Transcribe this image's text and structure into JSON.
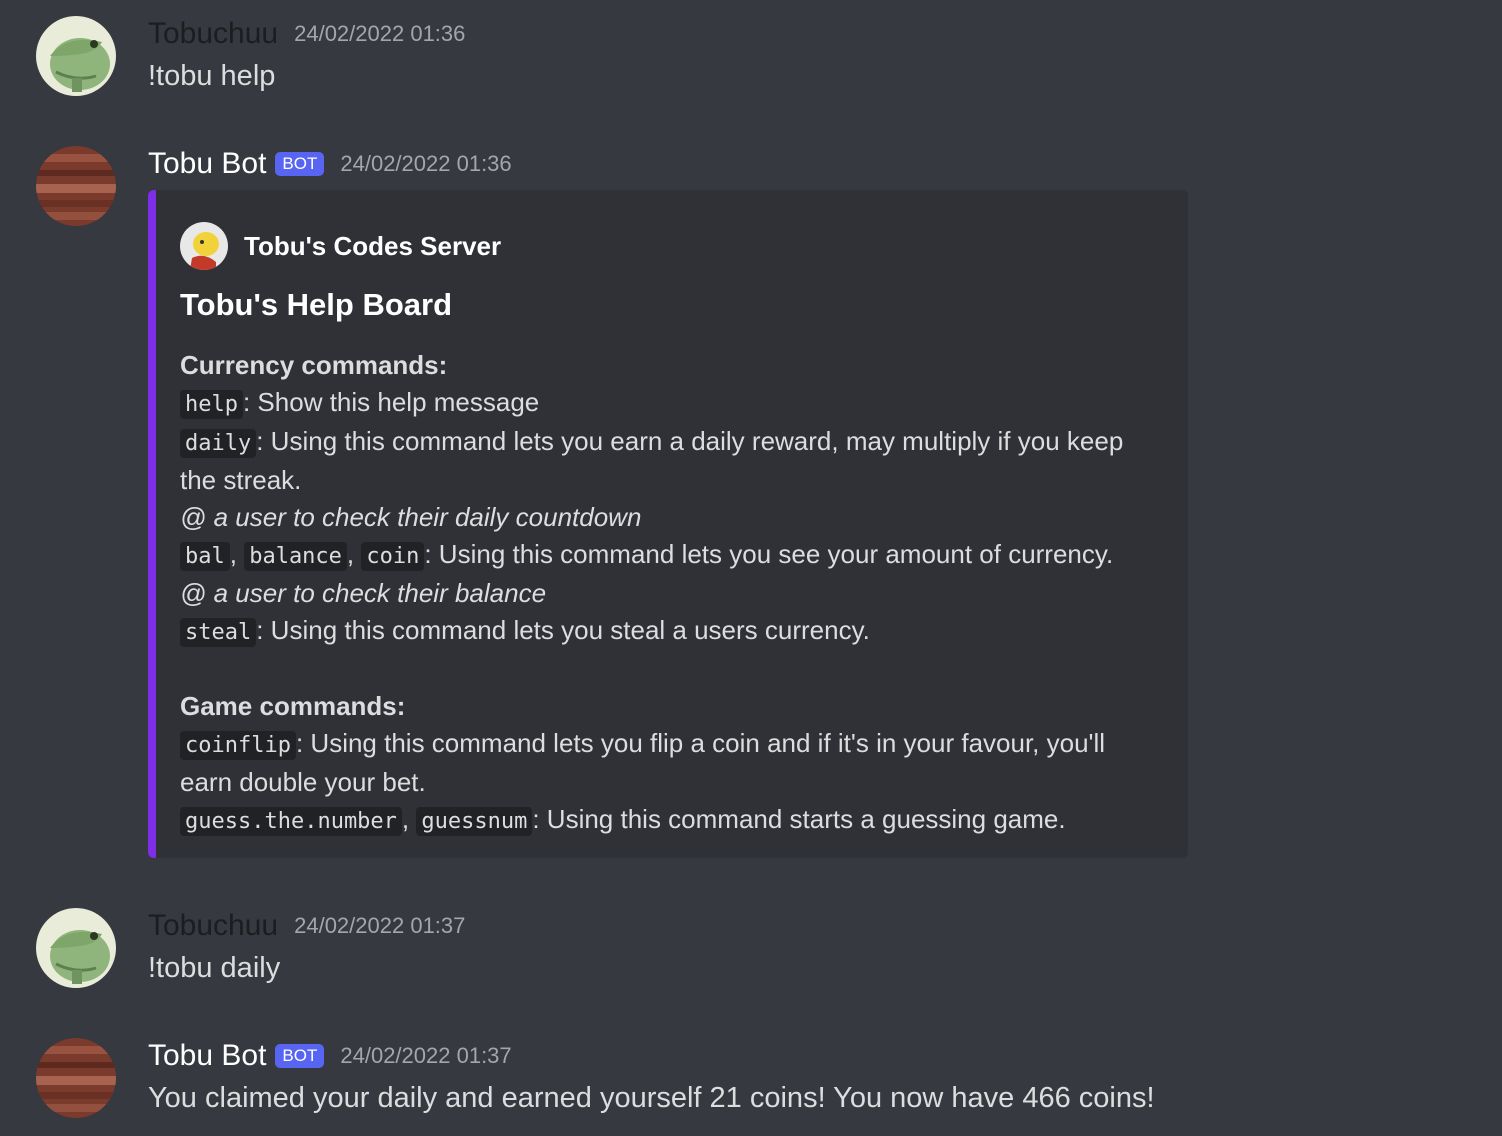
{
  "messages": [
    {
      "username": "Tobuchuu",
      "timestamp": "24/02/2022 01:36",
      "content": "!tobu help"
    },
    {
      "username": "Tobu Bot",
      "bot_tag": "BOT",
      "timestamp": "24/02/2022 01:36",
      "embed": {
        "author_name": "Tobu's Codes Server",
        "title": "Tobu's Help Board",
        "currency_heading": "Currency commands:",
        "help_cmd": "help",
        "help_desc": ": Show this help message",
        "daily_cmd": "daily",
        "daily_desc_1": ": Using this command lets you earn a daily reward, may multiply if you keep",
        "daily_desc_2": "the streak.",
        "daily_note": "@ a user to check their daily countdown",
        "bal_cmd": "bal",
        "balance_cmd": "balance",
        "coin_cmd": "coin",
        "sep": ", ",
        "bal_desc": ": Using this command lets you see your amount of currency.",
        "bal_note": "@ a user to check their balance",
        "steal_cmd": "steal",
        "steal_desc": ": Using this command lets you steal a users currency.",
        "game_heading": "Game commands:",
        "coinflip_cmd": "coinflip",
        "coinflip_desc_1": ": Using this command lets you flip a coin and if it's in your favour, you'll",
        "coinflip_desc_2": "earn double your bet.",
        "guess_cmd": "guess.the.number",
        "guessnum_cmd": "guessnum",
        "guess_desc": ": Using this command starts a guessing game."
      }
    },
    {
      "username": "Tobuchuu",
      "timestamp": "24/02/2022 01:37",
      "content": "!tobu daily"
    },
    {
      "username": "Tobu Bot",
      "bot_tag": "BOT",
      "timestamp": "24/02/2022 01:37",
      "content": "You claimed your daily and earned yourself 21 coins! You now have 466 coins!"
    }
  ]
}
